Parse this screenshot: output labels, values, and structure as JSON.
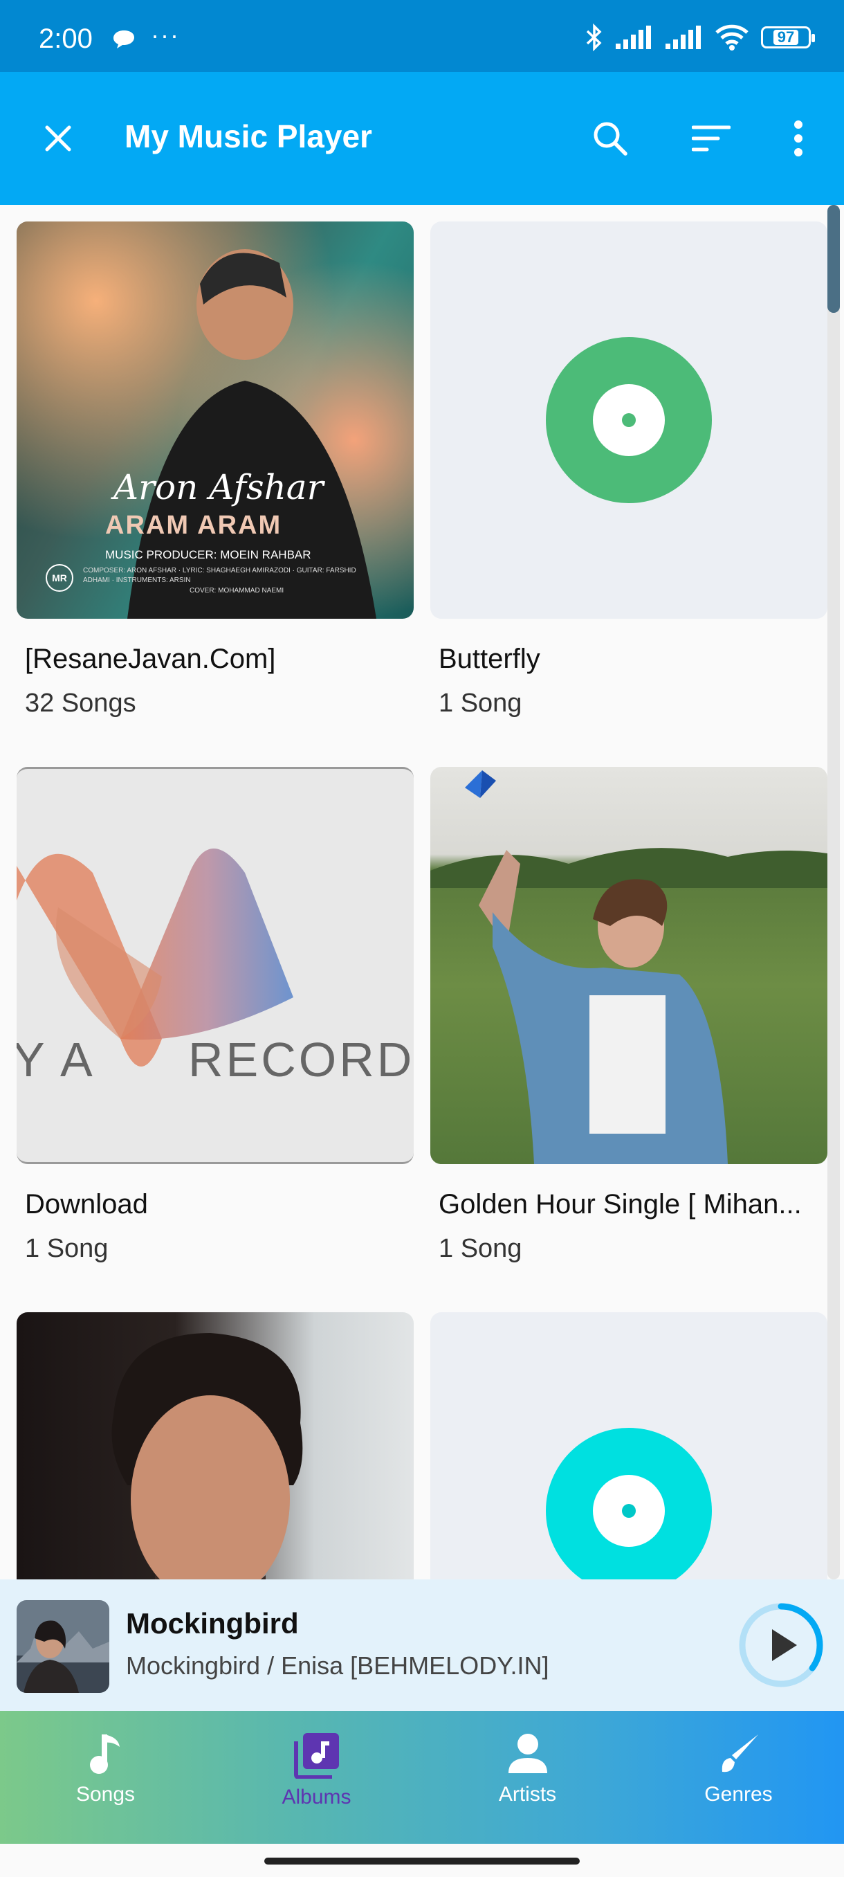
{
  "status_bar": {
    "time": "2:00",
    "dots": "···",
    "battery": "97"
  },
  "app_bar": {
    "title": "My Music Player"
  },
  "albums": [
    {
      "title": "[ResaneJavan.Com]",
      "count": "32 Songs",
      "art_text": {
        "artist": "Aron Afshar",
        "song": "ARAM ARAM",
        "producer": "MUSIC PRODUCER: MOEIN RAHBAR",
        "credits": "COMPOSER: ARON AFSHAR · LYRIC: SHAGHAEGH AMIRAZODI · GUITAR: FARSHID ADHAMI · INSTRUMENTS: ARSIN",
        "cover": "COVER: MOHAMMAD NAEMI",
        "logo": "MR"
      }
    },
    {
      "title": "Butterfly",
      "count": "1 Song",
      "placeholder_color": "#4cbb78"
    },
    {
      "title": "Download",
      "count": "1 Song",
      "art_text": {
        "left": "Y A",
        "right": "RECORD"
      }
    },
    {
      "title": "Golden Hour Single [ Mihan...",
      "count": "1 Song"
    },
    {
      "title": "",
      "count": ""
    },
    {
      "title": "",
      "count": "",
      "placeholder_color": "#00e0e0"
    }
  ],
  "now_playing": {
    "title": "Mockingbird",
    "subtitle": "Mockingbird / Enisa [BEHMELODY.IN]",
    "progress": 0.35
  },
  "nav": {
    "songs": "Songs",
    "albums": "Albums",
    "artists": "Artists",
    "genres": "Genres"
  },
  "colors": {
    "status_bar": "#0288d1",
    "app_bar": "#03a9f4",
    "active_tab": "#5e35b1",
    "accent": "#03a9f4"
  }
}
